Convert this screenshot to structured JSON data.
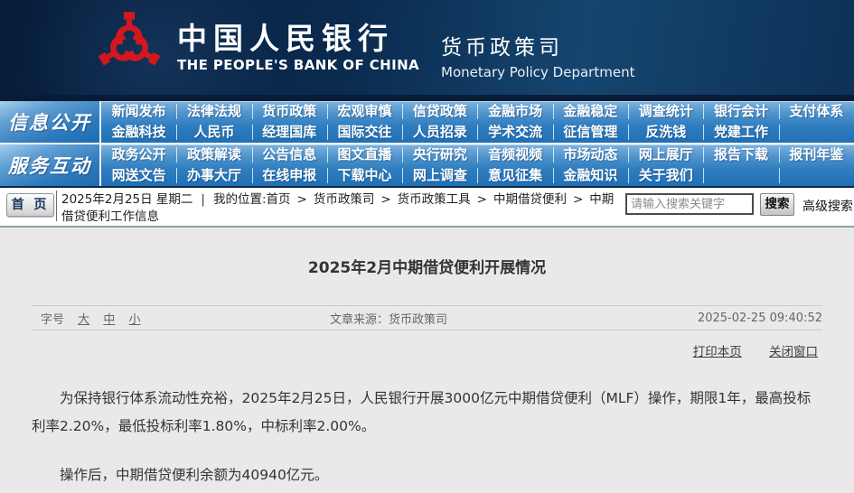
{
  "colors": {
    "header_navy": "#0a2a4e",
    "nav_blue": "#2575b8",
    "logo_red": "#d2181e",
    "content_bg": "#e9e9e9"
  },
  "header": {
    "logo": "pboc-emblem-icon",
    "bank_name_cn": "中国人民银行",
    "bank_name_en": "THE PEOPLE'S BANK OF CHINA",
    "dept_cn": "货币政策司",
    "dept_en": "Monetary Policy Department"
  },
  "nav": {
    "groups": [
      {
        "label": "信息公开",
        "rows": [
          [
            "新闻发布",
            "法律法规",
            "货币政策",
            "宏观审慎",
            "信贷政策",
            "金融市场",
            "金融稳定",
            "调查统计",
            "银行会计",
            "支付体系"
          ],
          [
            "金融科技",
            "人民币",
            "经理国库",
            "国际交往",
            "人员招录",
            "学术交流",
            "征信管理",
            "反洗钱",
            "党建工作",
            ""
          ]
        ]
      },
      {
        "label": "服务互动",
        "rows": [
          [
            "政务公开",
            "政策解读",
            "公告信息",
            "图文直播",
            "央行研究",
            "音频视频",
            "市场动态",
            "网上展厅",
            "报告下载",
            "报刊年鉴"
          ],
          [
            "网送文告",
            "办事大厅",
            "在线申报",
            "下载中心",
            "网上调查",
            "意见征集",
            "金融知识",
            "关于我们",
            "",
            ""
          ]
        ]
      }
    ]
  },
  "breadcrumb": {
    "home_button": "首 页",
    "date": "2025年2月25日 星期二",
    "bar_separator": "|",
    "location_prefix": "我的位置:首页",
    "separator": ">",
    "trail": [
      "货币政策司",
      "货币政策工具",
      "中期借贷便利",
      "中期借贷便利工作信息"
    ],
    "search": {
      "placeholder": "请输入搜索关键字",
      "button": "搜索",
      "advanced": "高级搜索"
    }
  },
  "article": {
    "title": "2025年2月中期借贷便利开展情况",
    "meta": {
      "font_size_label": "字号",
      "sizes": [
        "大",
        "中",
        "小"
      ],
      "source_label": "文章来源：",
      "source": "货币政策司",
      "datetime": "2025-02-25 09:40:52"
    },
    "actions": {
      "print": "打印本页",
      "close": "关闭窗口"
    },
    "paragraphs": [
      "为保持银行体系流动性充裕，2025年2月25日，人民银行开展3000亿元中期借贷便利（MLF）操作，期限1年，最高投标利率2.20%，最低投标利率1.80%，中标利率2.00%。",
      "操作后，中期借贷便利余额为40940亿元。"
    ]
  }
}
